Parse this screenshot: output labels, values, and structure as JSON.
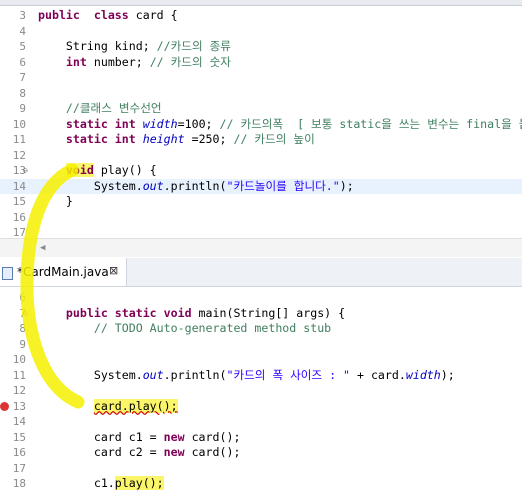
{
  "tabs_top": [],
  "editor1": {
    "lines": [
      {
        "n": "3",
        "parts": [
          [
            "kw",
            "public"
          ],
          [
            "",
            "  "
          ],
          [
            "kw",
            "class"
          ],
          [
            "",
            " card {"
          ]
        ]
      },
      {
        "n": "4",
        "parts": []
      },
      {
        "n": "5",
        "parts": [
          [
            "",
            "    String kind; "
          ],
          [
            "cm",
            "//카드의 종류"
          ]
        ]
      },
      {
        "n": "6",
        "parts": [
          [
            "",
            "    "
          ],
          [
            "kw",
            "int"
          ],
          [
            "",
            " number; "
          ],
          [
            "cm",
            "// 카드의 숫자"
          ]
        ]
      },
      {
        "n": "7",
        "parts": []
      },
      {
        "n": "8",
        "parts": []
      },
      {
        "n": "9",
        "parts": [
          [
            "",
            "    "
          ],
          [
            "cm",
            "//클래스 변수선언"
          ]
        ]
      },
      {
        "n": "10",
        "parts": [
          [
            "",
            "    "
          ],
          [
            "kw",
            "static int"
          ],
          [
            "",
            " "
          ],
          [
            "fld",
            "width"
          ],
          [
            "",
            "=100; "
          ],
          [
            "cm",
            "// 카드의폭  [ 보통 static을 쓰는 변수는 final을 붙인다"
          ]
        ]
      },
      {
        "n": "11",
        "parts": [
          [
            "",
            "    "
          ],
          [
            "kw",
            "static int"
          ],
          [
            "",
            " "
          ],
          [
            "fld",
            "height"
          ],
          [
            "",
            " =250; "
          ],
          [
            "cm",
            "// 카드의 높이"
          ]
        ]
      },
      {
        "n": "12",
        "parts": []
      },
      {
        "n": "13",
        "parts": [
          [
            "",
            "    "
          ],
          [
            "kw",
            "void"
          ],
          [
            "",
            " play() {"
          ]
        ]
      },
      {
        "n": "14",
        "parts": [
          [
            "",
            "        System."
          ],
          [
            "fld",
            "out"
          ],
          [
            ".println(",
            ""
          ],
          [
            "st",
            "\"카드놀이를 합니다.\""
          ],
          [
            "",
            ");"
          ]
        ]
      },
      {
        "n": "15",
        "parts": [
          [
            "",
            "    }"
          ]
        ]
      },
      {
        "n": "16",
        "parts": []
      },
      {
        "n": "17",
        "parts": []
      }
    ]
  },
  "editor2": {
    "tab_label": "*CardMain.java",
    "tab_close": "⊠",
    "lines": [
      {
        "n": "6",
        "parts": []
      },
      {
        "n": "7",
        "parts": [
          [
            "",
            "    "
          ],
          [
            "kw",
            "public static void"
          ],
          [
            "",
            " main(String[] args) {"
          ]
        ]
      },
      {
        "n": "8",
        "parts": [
          [
            "",
            "        "
          ],
          [
            "cm",
            "// TODO Auto-generated method stub"
          ]
        ]
      },
      {
        "n": "9",
        "parts": []
      },
      {
        "n": "10",
        "parts": []
      },
      {
        "n": "11",
        "parts": [
          [
            "",
            "        System."
          ],
          [
            "fld",
            "out"
          ],
          [
            "",
            ".println("
          ],
          [
            "st",
            "\"카드의 폭 사이즈 : \""
          ],
          [
            "",
            " + card."
          ],
          [
            "fld",
            "width"
          ],
          [
            "",
            ");"
          ]
        ]
      },
      {
        "n": "12",
        "parts": []
      },
      {
        "n": "13",
        "parts": [
          [
            "",
            "        "
          ],
          [
            "hl",
            "card.play();"
          ]
        ]
      },
      {
        "n": "14",
        "parts": []
      },
      {
        "n": "15",
        "parts": [
          [
            "",
            "        card c1 = "
          ],
          [
            "kw",
            "new"
          ],
          [
            "",
            " card();"
          ]
        ]
      },
      {
        "n": "16",
        "parts": [
          [
            "",
            "        card c2 = "
          ],
          [
            "kw",
            "new"
          ],
          [
            "",
            " card();"
          ]
        ]
      },
      {
        "n": "17",
        "parts": []
      },
      {
        "n": "18",
        "parts": [
          [
            "",
            "        c1."
          ],
          [
            "hl",
            "play();"
          ]
        ]
      }
    ]
  },
  "annotation": {
    "color": "#f5f000"
  }
}
